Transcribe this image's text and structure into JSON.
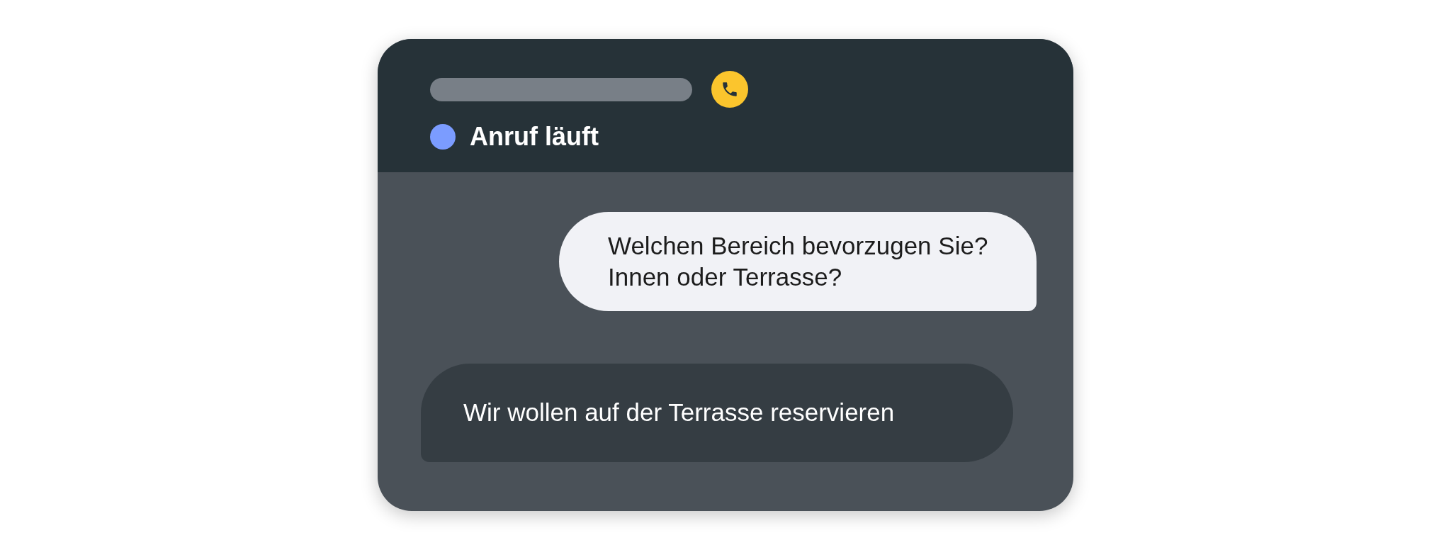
{
  "call": {
    "status": {
      "label": "Anruf läuft",
      "color": "#7b9cff"
    }
  },
  "messages": [
    {
      "kind": "outgoing",
      "text": "Welchen Bereich bevorzugen Sie? Innen oder Terrasse?"
    },
    {
      "kind": "incoming",
      "text": "Wir wollen auf der Terrasse reservieren"
    }
  ]
}
